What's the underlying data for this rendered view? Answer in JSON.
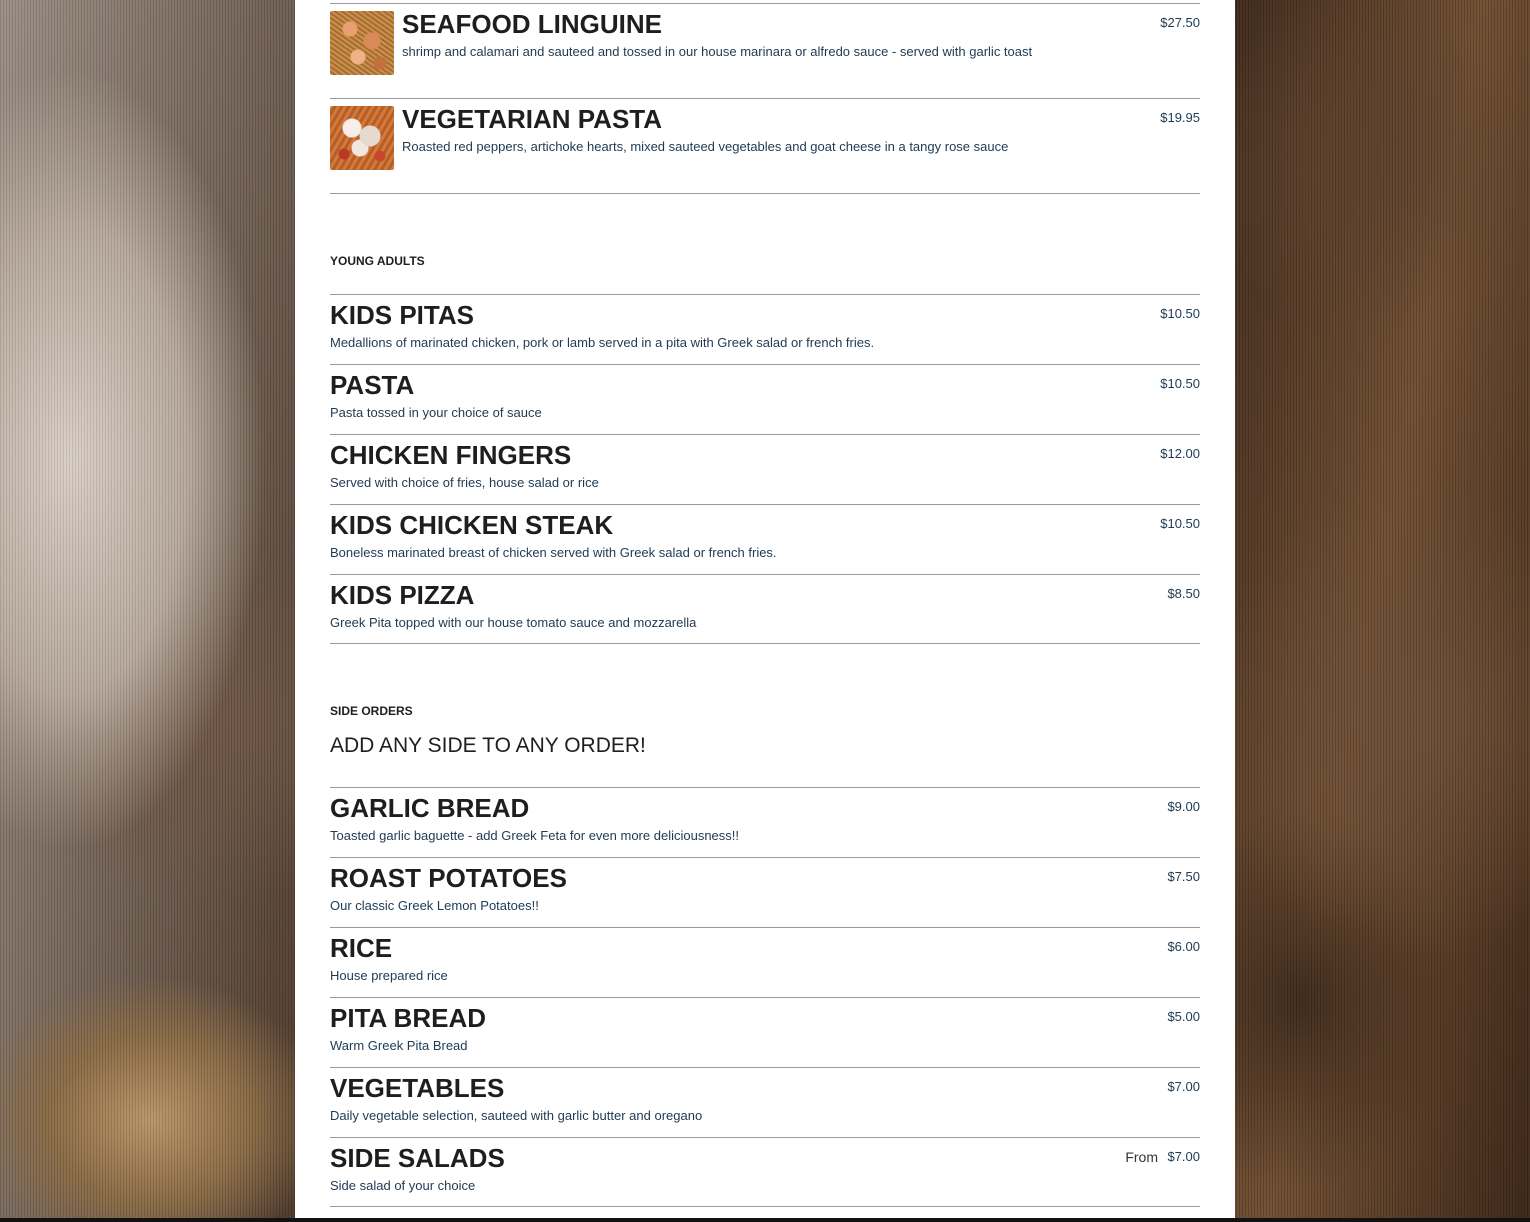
{
  "sections": {
    "pasta_tail": {
      "items": [
        {
          "name": "SEAFOOD LINGUINE",
          "desc": "shrimp and calamari and sauteed and tossed in our house marinara or alfredo sauce - served with garlic toast",
          "price": "$27.50",
          "thumb": "seafood-linguine-photo"
        },
        {
          "name": "VEGETARIAN PASTA",
          "desc": "Roasted red peppers, artichoke hearts, mixed sauteed vegetables and goat cheese in a tangy rose sauce",
          "price": "$19.95",
          "thumb": "vegetarian-pasta-photo"
        }
      ]
    },
    "young_adults": {
      "title": "YOUNG ADULTS",
      "items": [
        {
          "name": "KIDS PITAS",
          "desc": "Medallions of marinated chicken, pork or lamb served in a pita with Greek salad or french fries.",
          "price": "$10.50"
        },
        {
          "name": "PASTA",
          "desc": "Pasta tossed in your choice of sauce",
          "price": "$10.50"
        },
        {
          "name": "CHICKEN FINGERS",
          "desc": "Served with choice of fries, house salad or rice",
          "price": "$12.00"
        },
        {
          "name": "KIDS CHICKEN STEAK",
          "desc": "Boneless marinated breast of chicken served with Greek salad or french fries.",
          "price": "$10.50"
        },
        {
          "name": "KIDS PIZZA",
          "desc": "Greek Pita topped with our house tomato sauce and mozzarella",
          "price": "$8.50"
        }
      ]
    },
    "side_orders": {
      "title": "SIDE ORDERS",
      "note": "ADD ANY SIDE TO ANY ORDER!",
      "items": [
        {
          "name": "GARLIC BREAD",
          "desc": "Toasted garlic baguette - add Greek Feta for even more deliciousness!!",
          "price": "$9.00"
        },
        {
          "name": "ROAST POTATOES",
          "desc": "Our classic Greek Lemon Potatoes!!",
          "price": "$7.50"
        },
        {
          "name": "RICE",
          "desc": "House prepared rice",
          "price": "$6.00"
        },
        {
          "name": "PITA BREAD",
          "desc": "Warm Greek Pita Bread",
          "price": "$5.00"
        },
        {
          "name": "VEGETABLES",
          "desc": "Daily vegetable selection, sauteed with garlic butter and oregano",
          "price": "$7.00"
        },
        {
          "name": "SIDE SALADS",
          "desc": "Side salad of your choice",
          "price": "$7.00",
          "from": "From"
        }
      ]
    }
  },
  "colors": {
    "panel": "#ffffff",
    "item_name": "#1e1e1e",
    "desc_price": "#1f3a52",
    "divider": "#9a9a9a"
  }
}
